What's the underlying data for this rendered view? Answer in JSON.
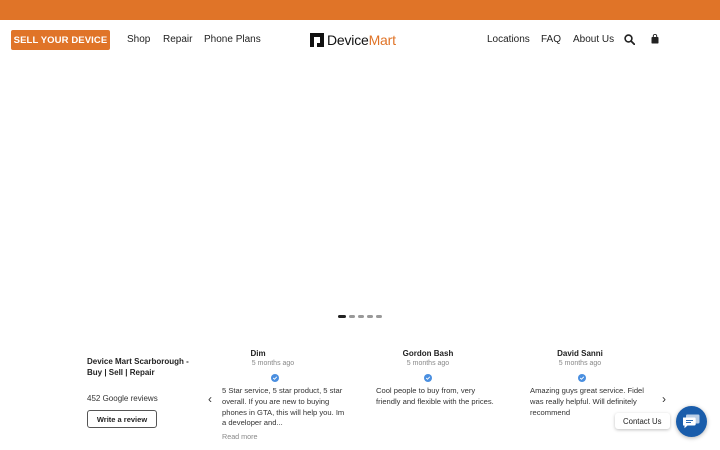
{
  "header": {
    "sell_button": "SELL YOUR DEVICE",
    "nav_left": [
      "Shop",
      "Repair",
      "Phone Plans"
    ],
    "logo_part1": "Device",
    "logo_part2": "Mart",
    "nav_right": [
      "Locations",
      "FAQ",
      "About Us"
    ],
    "icons": [
      "search-icon",
      "bag-icon"
    ]
  },
  "colors": {
    "accent": "#e07428",
    "chat": "#1a5dab",
    "verified": "#4a8fe0"
  },
  "carousel": {
    "slide_count": 5,
    "active_index": 0
  },
  "reviews_widget": {
    "business_name": "Device Mart Scarborough - Buy | Sell | Repair",
    "review_count": "452 Google reviews",
    "write_button": "Write a review",
    "reviews": [
      {
        "name": "Dim",
        "time": "5 months ago",
        "text": "5 Star service, 5 star product, 5 star overall. If you are new to buying phones in GTA, this will help you. Im a developer and...",
        "read_more": "Read more"
      },
      {
        "name": "Gordon Bash",
        "time": "5 months ago",
        "text": "Cool people to buy from, very friendly and flexible with the prices.",
        "read_more": ""
      },
      {
        "name": "David Sanni",
        "time": "5 months ago",
        "text": "Amazing guys great service. Fidel was really helpful. Will definitely recommend",
        "read_more": ""
      }
    ]
  },
  "chat": {
    "contact_label": "Contact Us"
  }
}
